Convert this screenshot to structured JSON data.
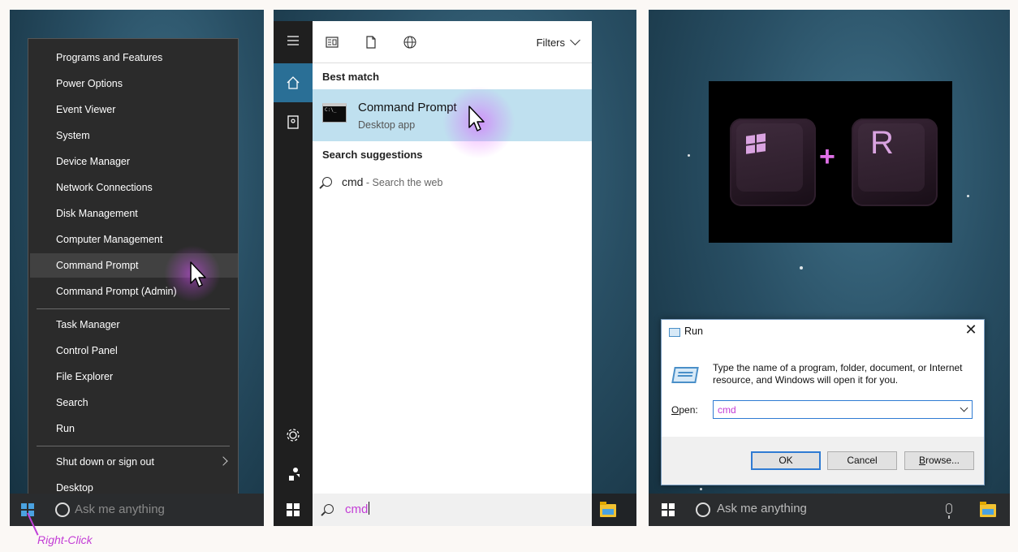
{
  "panel1": {
    "menu_items": [
      "Programs and Features",
      "Power Options",
      "Event Viewer",
      "System",
      "Device Manager",
      "Network Connections",
      "Disk Management",
      "Computer Management",
      "Command Prompt",
      "Command Prompt (Admin)",
      "Task Manager",
      "Control Panel",
      "File Explorer",
      "Search",
      "Run",
      "Shut down or sign out",
      "Desktop"
    ],
    "taskbar_placeholder": "Ask me anything",
    "annotation": "Right-Click",
    "annotation_color": "#c33dd6"
  },
  "panel2": {
    "filters_label": "Filters",
    "best_match_heading": "Best match",
    "best_match_title": "Command Prompt",
    "best_match_subtitle": "Desktop app",
    "cmd_icon_text": "C:\\_",
    "suggestions_heading": "Search suggestions",
    "suggestion_query": "cmd",
    "suggestion_hint": " - Search the web",
    "search_value": "cmd",
    "rail_icons": [
      "hamburger-icon",
      "home-icon",
      "notebook-icon",
      "gear-icon",
      "people-icon"
    ],
    "toolbar_icons": [
      "apps-icon",
      "documents-icon",
      "web-icon"
    ],
    "highlight_color": "#bfe0ef"
  },
  "panel3": {
    "key_left": "windows-key",
    "plus": "+",
    "key_right": "R",
    "dialog_title": "Run",
    "close_symbol": "✕",
    "description": "Type the name of a program, folder, document, or Internet resource, and Windows will open it for you.",
    "open_label_accel": "O",
    "open_label_rest": "pen:",
    "open_value": "cmd",
    "ok_label": "OK",
    "cancel_label": "Cancel",
    "browse_accel": "B",
    "browse_rest": "rowse...",
    "taskbar_placeholder": "Ask me anything"
  }
}
